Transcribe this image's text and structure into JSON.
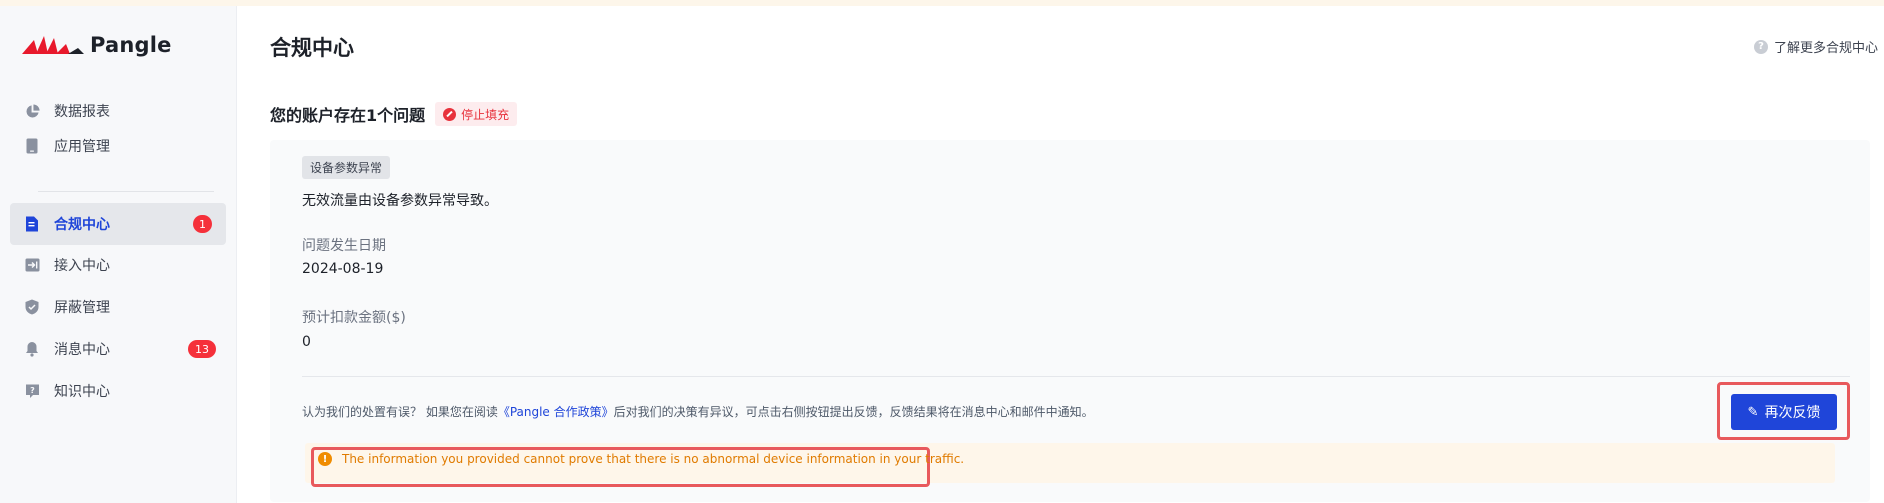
{
  "brand": {
    "name": "Pangle"
  },
  "sidebar": {
    "items": [
      {
        "label": "数据报表",
        "icon": "pie-chart-icon"
      },
      {
        "label": "应用管理",
        "icon": "phone-icon"
      },
      {
        "label": "合规中心",
        "icon": "document-icon",
        "active": true,
        "badge": "1"
      },
      {
        "label": "接入中心",
        "icon": "login-arrow-icon"
      },
      {
        "label": "屏蔽管理",
        "icon": "shield-icon"
      },
      {
        "label": "消息中心",
        "icon": "bell-icon",
        "badge": "13"
      },
      {
        "label": "知识中心",
        "icon": "question-box-icon"
      }
    ]
  },
  "header": {
    "title": "合规中心",
    "help_link": "了解更多合规中心"
  },
  "issue": {
    "title": "您的账户存在1个问题",
    "status": "停止填充",
    "type_tag": "设备参数异常",
    "description": "无效流量由设备参数异常导致。",
    "date_label": "问题发生日期",
    "date_value": "2024-08-19",
    "amount_label": "预计扣款金额($)",
    "amount_value": "0"
  },
  "appeal": {
    "text_before": "认为我们的处置有误？ 如果您在阅读",
    "policy_link": "《Pangle 合作政策》",
    "text_after": "后对我们的决策有异议，可点击右侧按钮提出反馈，反馈结果将在消息中心和邮件中通知。",
    "button_label": "再次反馈"
  },
  "warning": {
    "message": "The information you provided cannot prove that there is no abnormal device information in your traffic."
  },
  "colors": {
    "primary": "#1f45d9",
    "danger": "#f5303a",
    "warning": "#f08c00",
    "highlight": "#e8595c"
  }
}
